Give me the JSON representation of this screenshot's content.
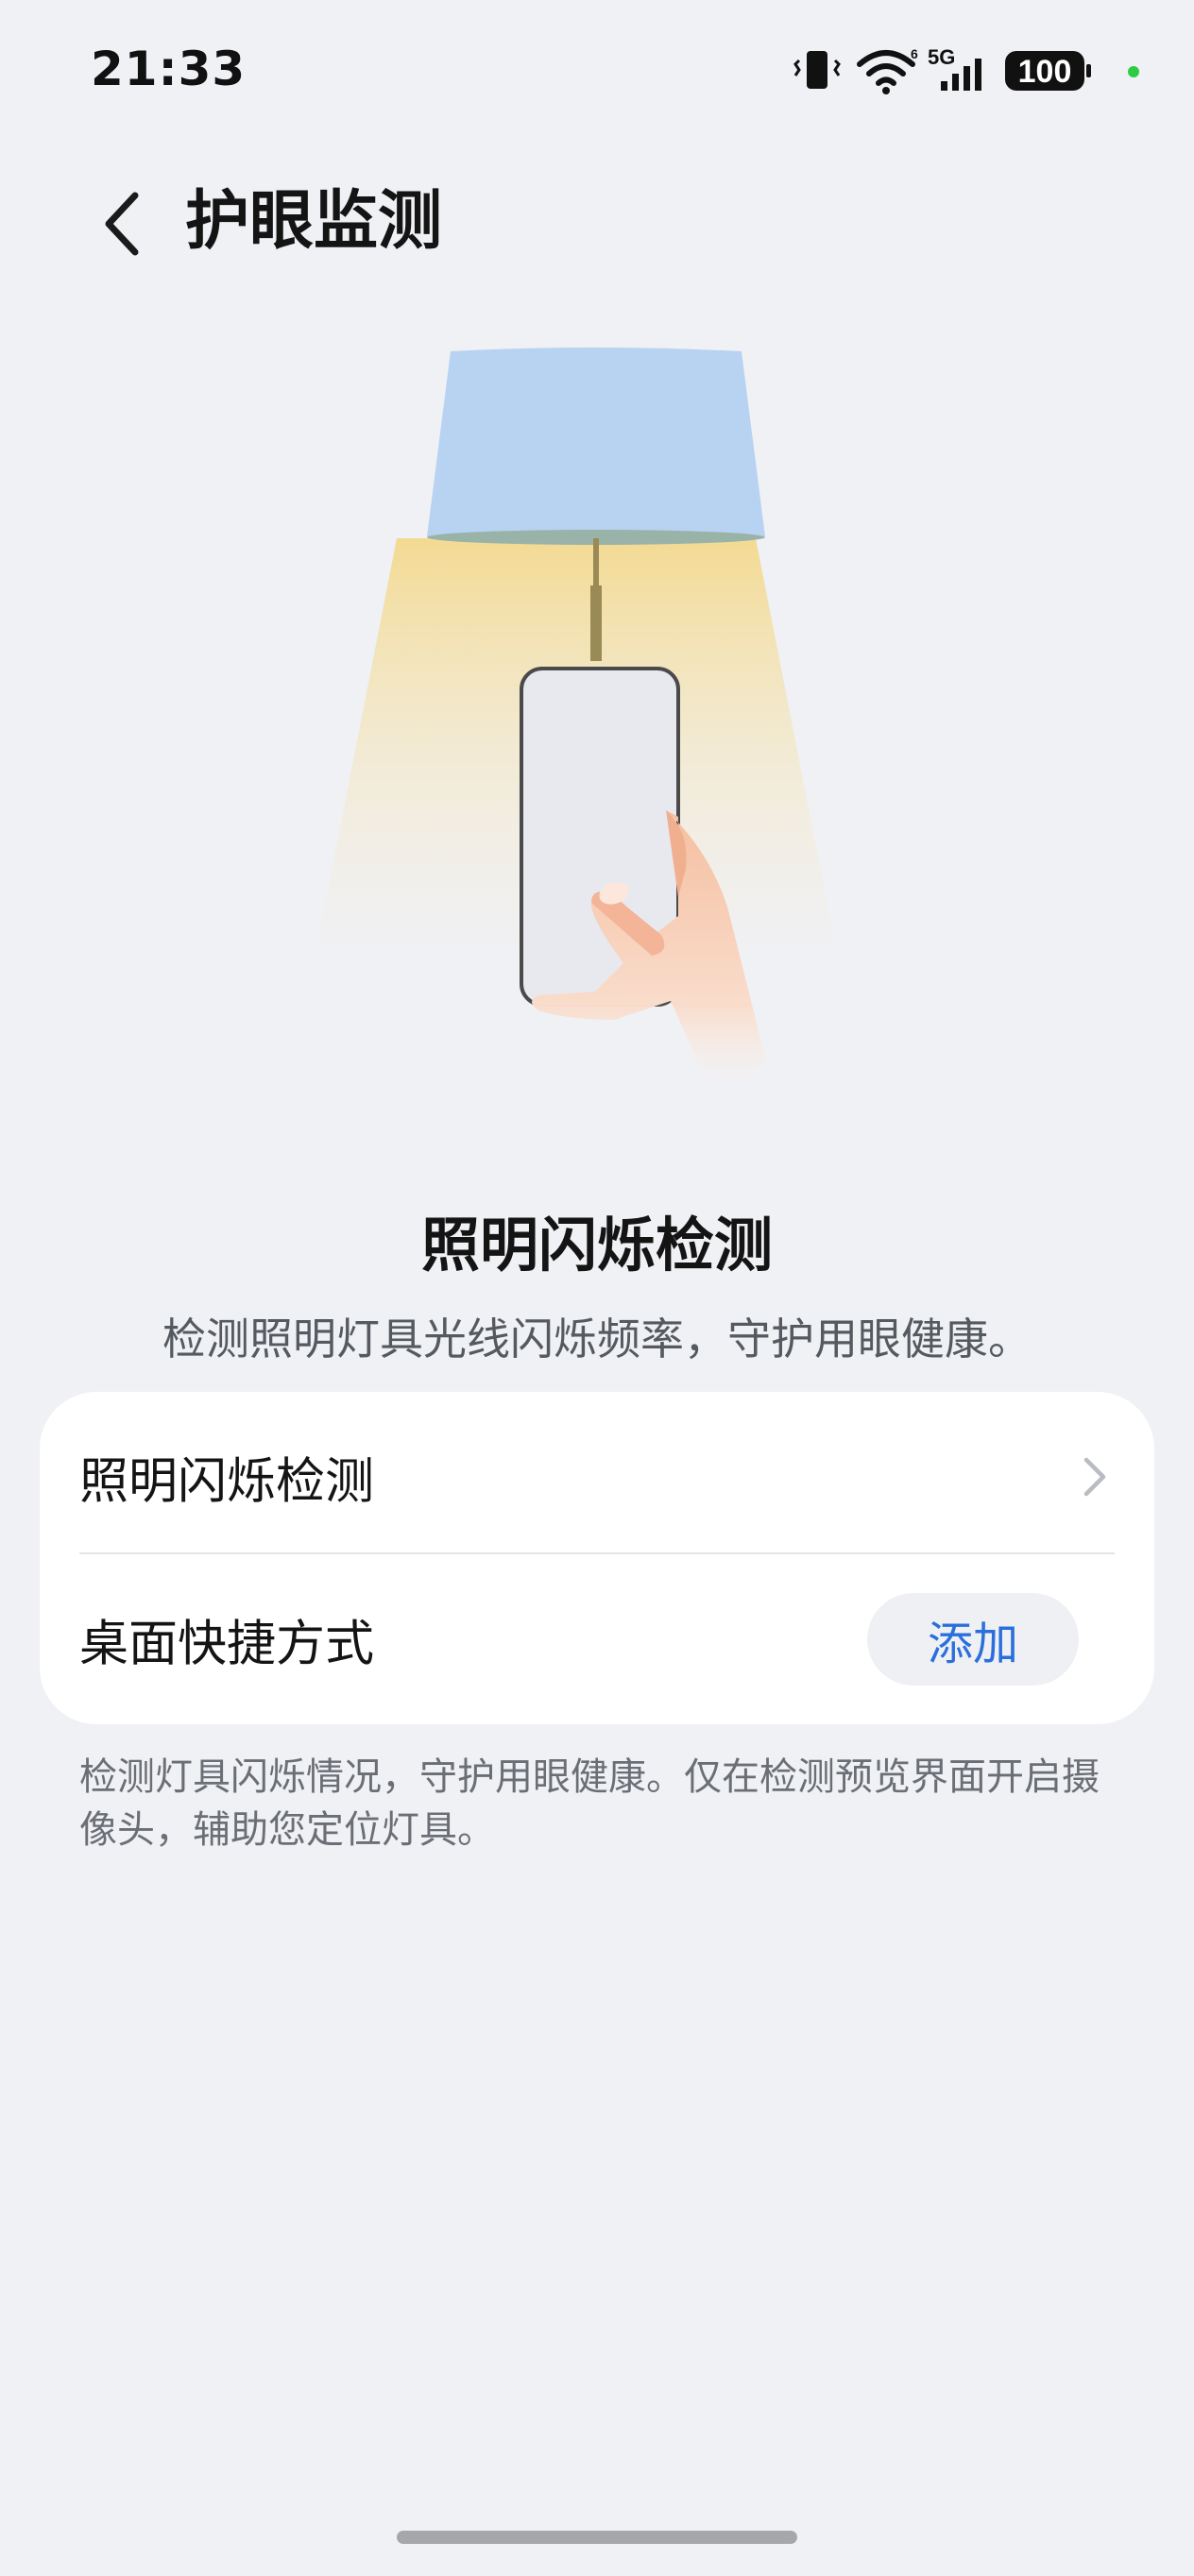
{
  "status_bar": {
    "time": "21:33",
    "network": "5G",
    "battery": "100",
    "icons": [
      "vibrate-icon",
      "wifi-icon",
      "signal-icon",
      "battery-icon",
      "indicator-dot"
    ],
    "indicator_color": "#2ecc40"
  },
  "header": {
    "title": "护眼监测",
    "back_icon": "chevron-left-icon"
  },
  "hero": {
    "title": "照明闪烁检测",
    "description": "检测照明灯具光线闪烁频率，守护用眼健康。"
  },
  "settings": {
    "items": [
      {
        "label": "照明闪烁检测",
        "action_icon": "chevron-right-icon"
      },
      {
        "label": "桌面快捷方式",
        "button_label": "添加"
      }
    ]
  },
  "footnote": "检测灯具闪烁情况，守护用眼健康。仅在检测预览界面开启摄像头，辅助您定位灯具。",
  "colors": {
    "background": "#f0f1f5",
    "accent": "#2a6fdb",
    "lampshade": "#b8d3f2",
    "light_beam": "#f3dfa0"
  }
}
